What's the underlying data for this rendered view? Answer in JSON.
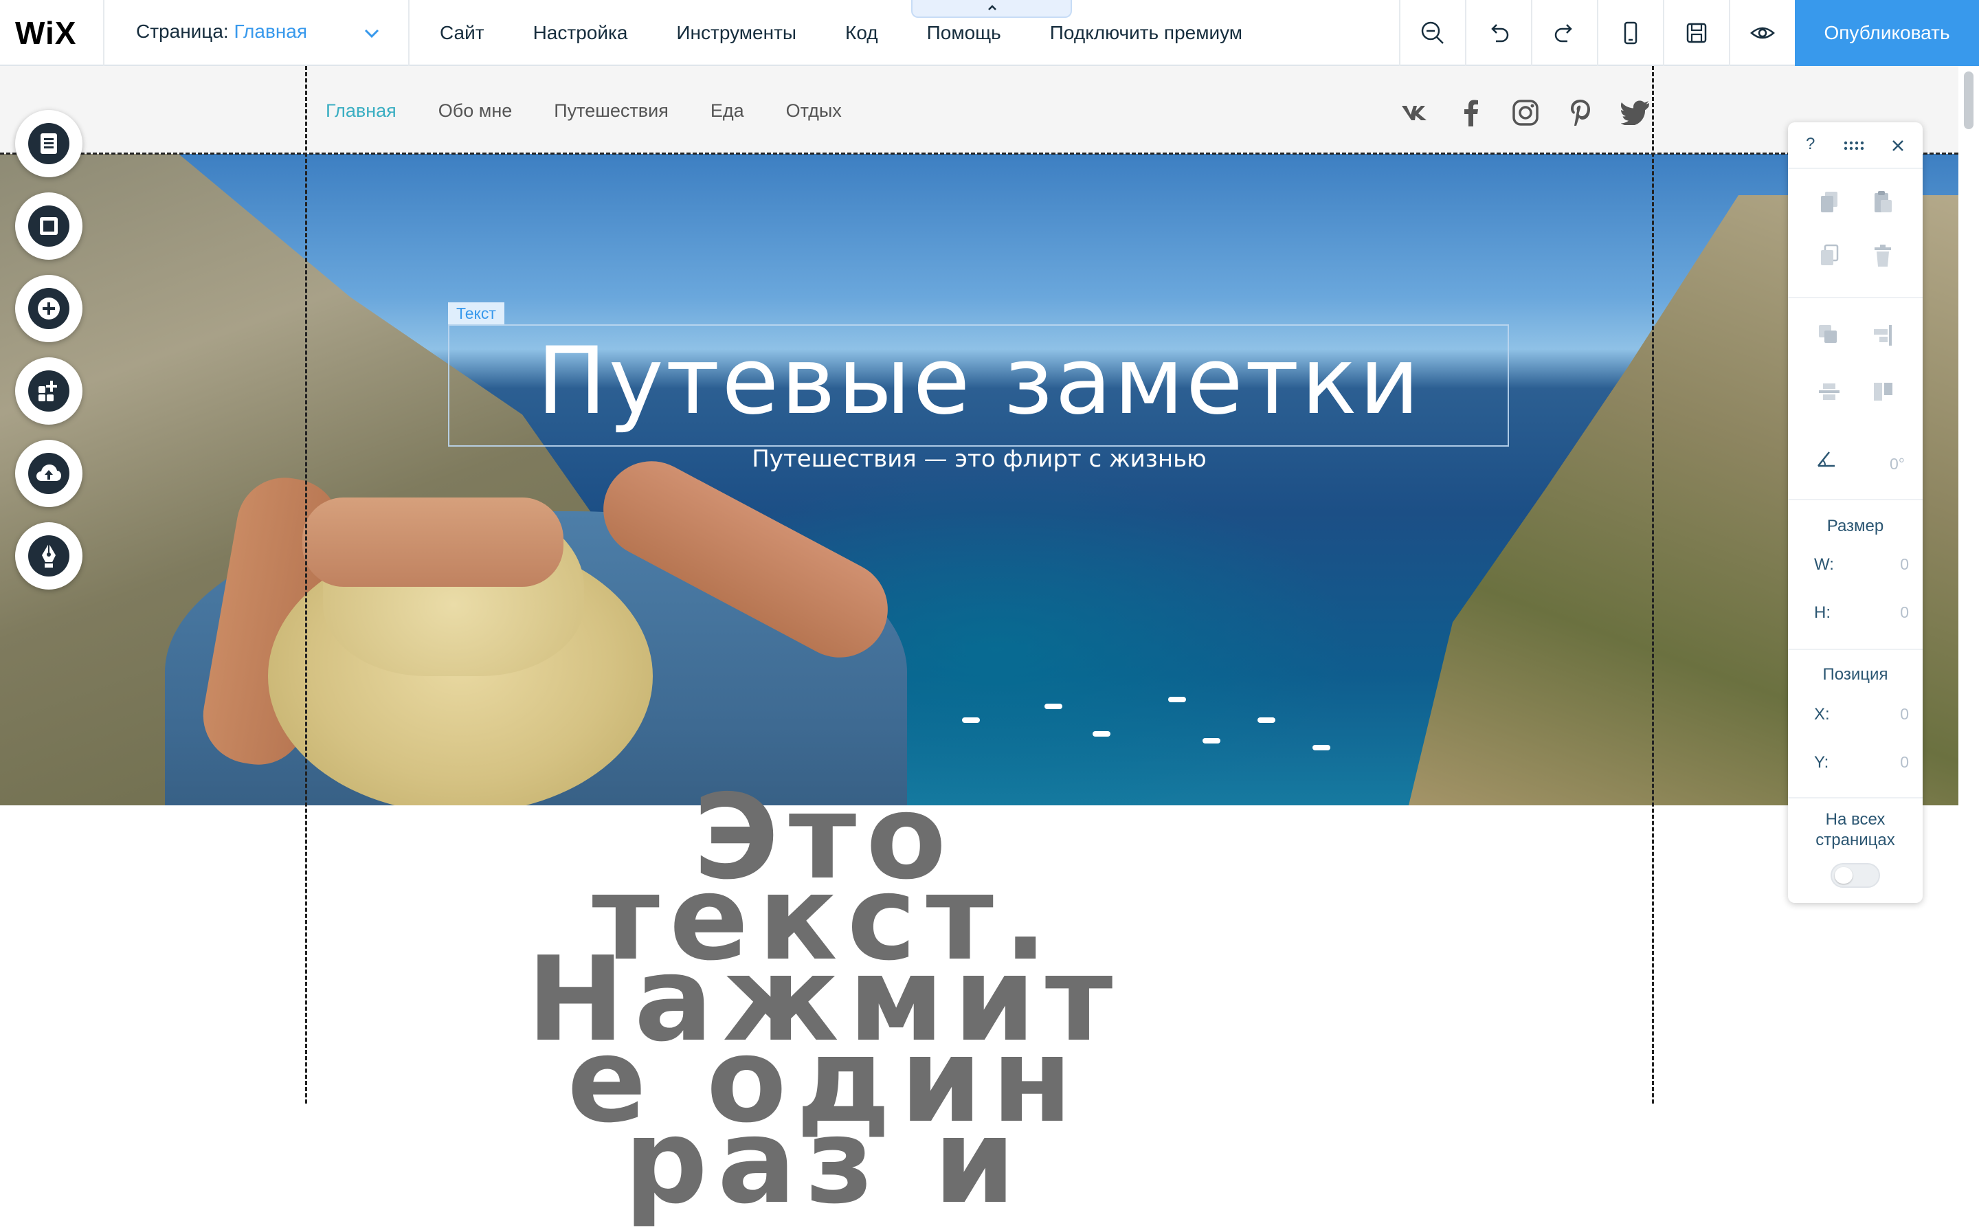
{
  "topbar": {
    "logo": "WiX",
    "page_label": "Страница:",
    "page_value": "Главная",
    "menu": [
      "Сайт",
      "Настройка",
      "Инструменты",
      "Код",
      "Помощь",
      "Подключить премиум"
    ],
    "tools": [
      "zoom-out-icon",
      "undo-icon",
      "redo-icon",
      "mobile-icon",
      "save-icon",
      "preview-icon"
    ],
    "publish": "Опубликовать"
  },
  "site": {
    "nav": [
      "Главная",
      "Обо мне",
      "Путешествия",
      "Еда",
      "Отдых"
    ],
    "nav_active_color": "#3aaec2",
    "social": [
      "vk-icon",
      "facebook-icon",
      "instagram-icon",
      "pinterest-icon",
      "twitter-icon"
    ],
    "hero_title": "Путевые заметки",
    "hero_subtitle": "Путешествия — это флирт с жизнью",
    "selection_tag": "Текст",
    "big_text_lines": [
      "Это",
      "текст.",
      "Нажмит",
      "е один",
      "раз и"
    ]
  },
  "left_toolbar": [
    "pages-icon",
    "background-icon",
    "add-icon",
    "app-market-icon",
    "upload-icon",
    "blog-pen-icon"
  ],
  "panel": {
    "help": "?",
    "size_label": "Размер",
    "w_label": "W:",
    "w_value": "0",
    "h_label": "H:",
    "h_value": "0",
    "position_label": "Позиция",
    "x_label": "X:",
    "x_value": "0",
    "y_label": "Y:",
    "y_value": "0",
    "rotation_value": "0°",
    "all_pages_line1": "На всех",
    "all_pages_line2": "страницах",
    "all_pages_enabled": false
  },
  "colors": {
    "accent": "#3899ec",
    "dark": "#162d3d"
  }
}
